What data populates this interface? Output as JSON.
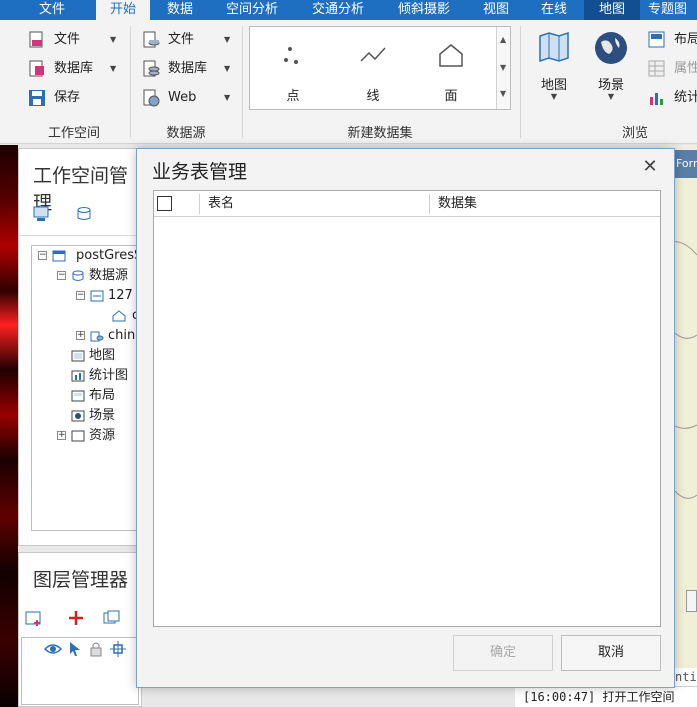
{
  "ribbon_tabs": [
    "文件",
    "开始",
    "数据",
    "空间分析",
    "交通分析",
    "倾斜摄影",
    "视图",
    "在线",
    "地图",
    "专题图"
  ],
  "active_tab": "开始",
  "workspace_group": {
    "label": "工作空间",
    "file": "文件",
    "database": "数据库",
    "save": "保存"
  },
  "datasource_group": {
    "label": "数据源",
    "file": "文件",
    "database": "数据库",
    "web": "Web"
  },
  "dataset_group": {
    "label": "新建数据集",
    "point": "点",
    "line": "线",
    "region": "面"
  },
  "browse_group": {
    "label": "浏览",
    "map": "地图",
    "scene": "场景",
    "layout": "布局",
    "attribute": "属性",
    "statistics": "统计"
  },
  "workspace_panel": {
    "title": "工作空间管理",
    "tree": {
      "root": "postGresS",
      "datasources": "数据源",
      "pg_source": "127",
      "pg_child": "c",
      "china_source": "chin",
      "maps": "地图",
      "charts": "统计图",
      "layouts": "布局",
      "scenes": "场景",
      "resources": "资源"
    }
  },
  "layer_panel": {
    "title": "图层管理器"
  },
  "map_caption": "Form",
  "log": {
    "prev": "ntit",
    "line": "[16:00:47] 打开工作空间 "
  },
  "dialog": {
    "title": "业务表管理",
    "columns": [
      "表名",
      "数据集"
    ],
    "ok": "确定",
    "cancel": "取消",
    "ok_enabled": false
  },
  "colors": {
    "ribbon_blue": "#1e6fc2",
    "dialog_border": "#7aa2cf",
    "map_fill": "#f1efd6"
  }
}
